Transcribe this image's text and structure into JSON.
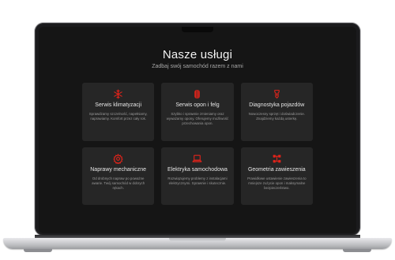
{
  "page": {
    "title": "Nasze usługi",
    "subtitle": "Zadbaj swój samochód razem z nami"
  },
  "accent_color": "#e2231a",
  "services": [
    {
      "icon": "snowflake-icon",
      "title": "Serwis klimatyzacji",
      "desc": "Sprawdzamy szczelność, napełniamy, naprawiamy. Komfort przez cały rok."
    },
    {
      "icon": "tire-icon",
      "title": "Serwis opon i felg",
      "desc": "Szybko i sprawnie zmieniamy oraz wyważamy opony. Oferujemy możliwość przechowania opon."
    },
    {
      "icon": "engine-icon",
      "title": "Diagnostyka pojazdów",
      "desc": "Nowoczesny sprzęt i doświadczenie. Znajdziemy każdą usterkę."
    },
    {
      "icon": "gear-icon",
      "title": "Naprawy mechaniczne",
      "desc": "Od drobnych napraw po poważne awarie. Twój samochód w dobrych rękach."
    },
    {
      "icon": "laptop-icon",
      "title": "Elektryka samochodowa",
      "desc": "Rozwiązujemy problemy z instalacjami elektrycznymi. Sprawnie i skutecznie."
    },
    {
      "icon": "alignment-icon",
      "title": "Geometria zawieszenia",
      "desc": "Prawidłowe ustawienie zawieszenia to mniejsze zużycie opon i maksymalne bezpieczeństwo."
    }
  ]
}
